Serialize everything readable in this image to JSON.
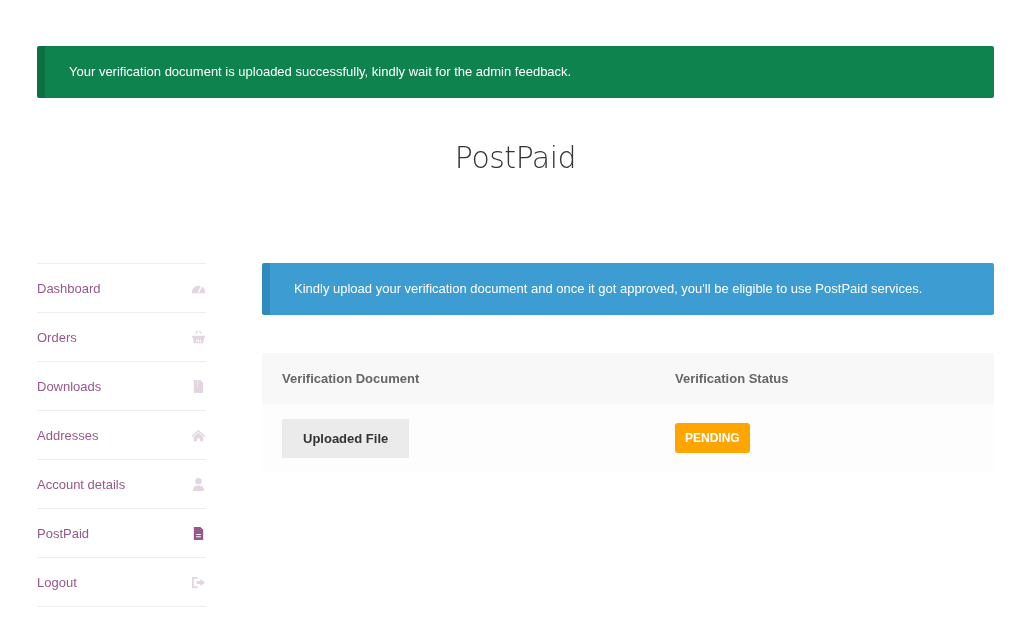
{
  "success_notice": "Your verification document is uploaded successfully, kindly wait for the admin feedback.",
  "page_title": "PostPaid",
  "sidebar": {
    "items": [
      {
        "label": "Dashboard",
        "kind": "gauge",
        "selected": false
      },
      {
        "label": "Orders",
        "kind": "basket",
        "selected": false
      },
      {
        "label": "Downloads",
        "kind": "file",
        "selected": false
      },
      {
        "label": "Addresses",
        "kind": "home",
        "selected": false
      },
      {
        "label": "Account details",
        "kind": "user",
        "selected": false
      },
      {
        "label": "PostPaid",
        "kind": "document",
        "selected": true
      },
      {
        "label": "Logout",
        "kind": "logout",
        "selected": false
      }
    ]
  },
  "info_notice": "Kindly upload your verification document and once it got approved, you'll be eligible to use PostPaid services.",
  "table": {
    "columns": [
      "Verification Document",
      "Verification Status"
    ],
    "rows": [
      {
        "document_button": "Uploaded File",
        "status": "PENDING"
      }
    ]
  }
}
